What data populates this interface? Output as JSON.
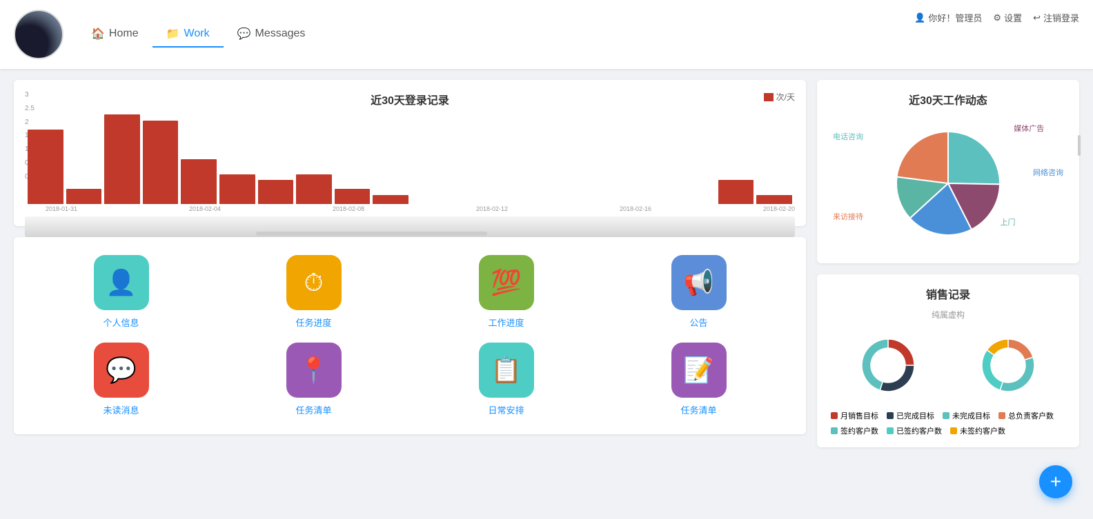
{
  "header": {
    "user_greeting": "你好！管理员",
    "settings_label": "设置",
    "logout_label": "注销登录",
    "nav_home": "Home",
    "nav_work": "Work",
    "nav_messages": "Messages"
  },
  "login_chart": {
    "title": "近30天登录记录",
    "legend_label": "次/天",
    "x_labels": [
      "2018-01-31",
      "2018-02-04",
      "2018-02-08",
      "2018-02-12",
      "2018-02-16",
      "2018-02-20"
    ],
    "bars": [
      2.5,
      0.5,
      3,
      2.8,
      1.5,
      1,
      0.8,
      1,
      0.5,
      0.3,
      0,
      0,
      0,
      0,
      0,
      0,
      0,
      0,
      0.8,
      0.3
    ],
    "y_labels": [
      "0",
      "0.5",
      "1",
      "1.5",
      "2",
      "2.5",
      "3"
    ]
  },
  "work_chart": {
    "title": "近30天工作动态",
    "segments": [
      {
        "label": "电话咨询",
        "color": "#5bc0be",
        "value": 22,
        "position": {
          "top": "20%",
          "left": "5%"
        }
      },
      {
        "label": "媒体广告",
        "color": "#8b4a6e",
        "value": 15,
        "position": {
          "top": "10%",
          "right": "8%"
        }
      },
      {
        "label": "网络咨询",
        "color": "#4a90d9",
        "value": 18,
        "position": {
          "top": "42%",
          "right": "4%"
        }
      },
      {
        "label": "上门",
        "color": "#5ab5a5",
        "value": 12,
        "position": {
          "bottom": "15%",
          "right": "20%"
        }
      },
      {
        "label": "来访接待",
        "color": "#e07b54",
        "value": 20,
        "position": {
          "bottom": "20%",
          "left": "4%"
        }
      }
    ]
  },
  "shortcuts": {
    "items": [
      {
        "label": "个人信息",
        "color": "#4ecdc4",
        "icon": "👤"
      },
      {
        "label": "任务进度",
        "color": "#f0a500",
        "icon": "⏱"
      },
      {
        "label": "工作进度",
        "color": "#7cb342",
        "icon": "💯"
      },
      {
        "label": "公告",
        "color": "#5b8dd9",
        "icon": "📢"
      },
      {
        "label": "未读消息",
        "color": "#e74c3c",
        "icon": "💬"
      },
      {
        "label": "任务清单",
        "color": "#9b59b6",
        "icon": "📍"
      },
      {
        "label": "日常安排",
        "color": "#4ecdc4",
        "icon": "📋"
      },
      {
        "label": "任务清单",
        "color": "#9b59b6",
        "icon": "📝"
      }
    ]
  },
  "sales_chart": {
    "title": "销售记录",
    "subtitle": "纯属虚构",
    "donut1": [
      {
        "color": "#c0392b",
        "pct": 25
      },
      {
        "color": "#2c3e50",
        "pct": 30
      },
      {
        "color": "#5bc0be",
        "pct": 45
      }
    ],
    "donut2": [
      {
        "color": "#e07b54",
        "pct": 20
      },
      {
        "color": "#5bc0be",
        "pct": 35
      },
      {
        "color": "#4ecdc4",
        "pct": 30
      },
      {
        "color": "#f0a500",
        "pct": 15
      }
    ],
    "legend": [
      {
        "color": "#c0392b",
        "label": "月销售目标"
      },
      {
        "color": "#2c3e50",
        "label": "已完成目标"
      },
      {
        "color": "#5bc0be",
        "label": "未完成目标"
      },
      {
        "color": "#e07b54",
        "label": "总负责客户数"
      },
      {
        "color": "#5bc0be",
        "label": "签约客户数"
      },
      {
        "color": "#4ecdc4",
        "label": "已签约客户数"
      },
      {
        "color": "#f0a500",
        "label": "未签约客户数"
      }
    ]
  },
  "fab": {
    "label": "+"
  }
}
